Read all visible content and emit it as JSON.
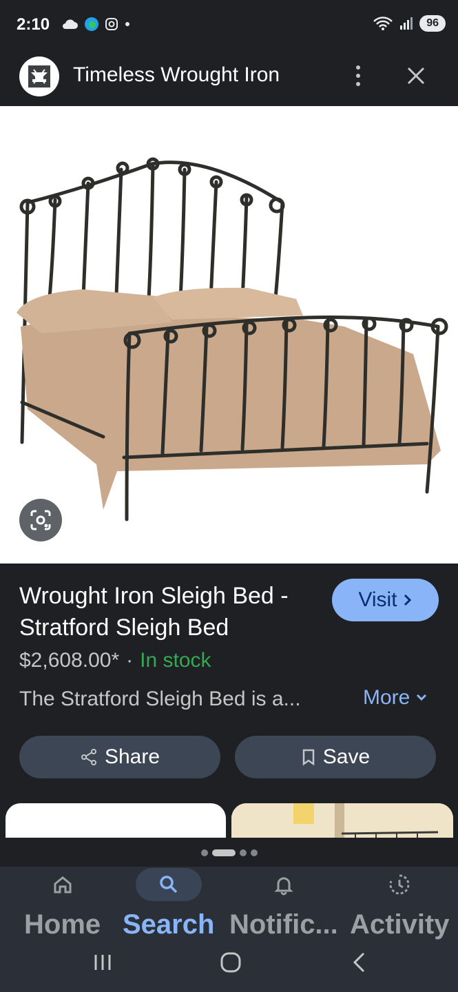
{
  "status_bar": {
    "time": "2:10",
    "battery": "96"
  },
  "header": {
    "site_name": "Timeless Wrought Iron"
  },
  "product": {
    "title": "Wrought Iron Sleigh Bed - Stratford Sleigh Bed",
    "price": "$2,608.00*",
    "separator": "·",
    "stock": "In stock",
    "description": "The Stratford Sleigh Bed is a...",
    "visit_label": "Visit",
    "more_label": "More"
  },
  "actions": {
    "share_label": "Share",
    "save_label": "Save"
  },
  "pager": {
    "count": 4,
    "active_index": 1
  },
  "bottom_nav": {
    "items": [
      {
        "label": "Home",
        "icon": "home-icon"
      },
      {
        "label": "Search",
        "icon": "search-icon",
        "active": true
      },
      {
        "label": "Notific...",
        "icon": "bell-icon"
      },
      {
        "label": "Activity",
        "icon": "history-icon"
      }
    ]
  },
  "colors": {
    "background": "#1f2023",
    "accent": "#8ab4f8",
    "in_stock": "#34a853",
    "button_bg": "#3d4655",
    "nav_bg": "#2b2f38"
  }
}
